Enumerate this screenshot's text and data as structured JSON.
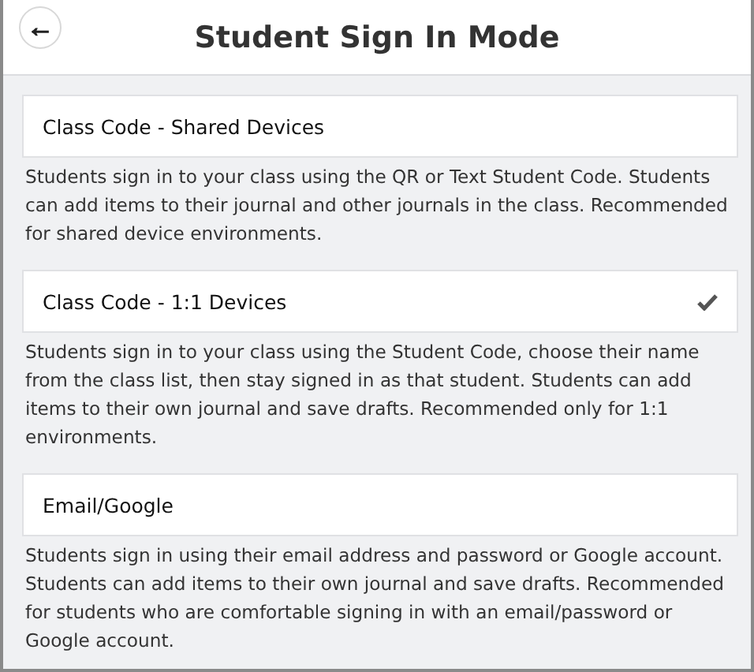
{
  "header": {
    "back_button": "←",
    "title": "Student Sign In Mode"
  },
  "options": [
    {
      "label": "Class Code - Shared Devices",
      "selected": false,
      "description": "Students sign in to your class using the QR or Text Student Code. Students can add items to their journal and other journals in the class. Recommended for shared device environments."
    },
    {
      "label": "Class Code - 1:1 Devices",
      "selected": true,
      "description": "Students sign in to your class using the Student Code, choose their name from the class list, then stay signed in as that student. Students can add items to their own journal and save drafts. Recommended only for 1:1 environments."
    },
    {
      "label": "Email/Google",
      "selected": false,
      "description": "Students sign in using their email address and password or Google account. Students can add items to their own journal and save drafts. Recommended for students who are comfortable signing in with an email/password or Google account."
    }
  ]
}
